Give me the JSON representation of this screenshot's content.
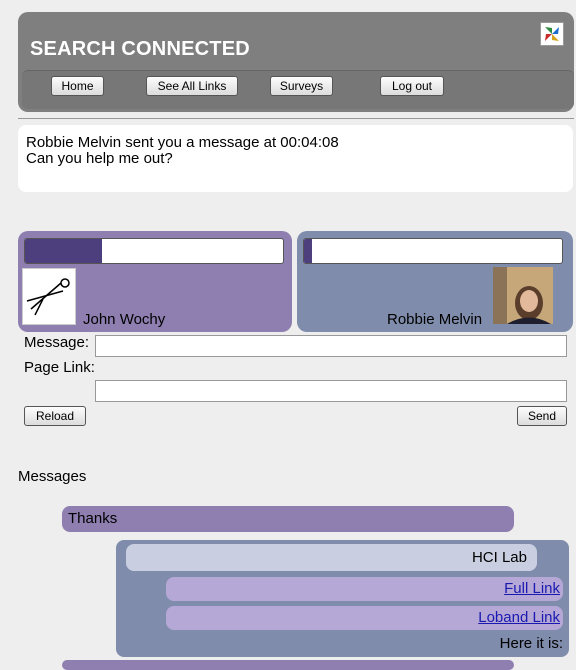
{
  "header": {
    "brand": "SEARCH CONNECTED"
  },
  "nav": {
    "home": "Home",
    "see_all_links": "See All Links",
    "surveys": "Surveys",
    "log_out": "Log out"
  },
  "notice": {
    "line1": "Robbie Melvin sent you a message at 00:04:08",
    "line2": "Can you help me out?"
  },
  "users": {
    "left": {
      "name": "John Wochy",
      "progress": 0.3
    },
    "right": {
      "name": "Robbie Melvin",
      "progress": 0.03
    }
  },
  "form": {
    "message_label": "Message:",
    "message_value": "",
    "page_link_label": "Page Link:",
    "page_link_value": "",
    "reload": "Reload",
    "send": "Send"
  },
  "messages": {
    "heading": "Messages",
    "items": [
      {
        "text": "Thanks"
      },
      {
        "title": "HCI Lab",
        "links": [
          "Full Link",
          "Loband Link"
        ],
        "text": "Here it is:"
      }
    ]
  },
  "colors": {
    "left_card": "#8e7fb0",
    "right_card": "#7f8cab",
    "header": "#7f7f7f"
  }
}
